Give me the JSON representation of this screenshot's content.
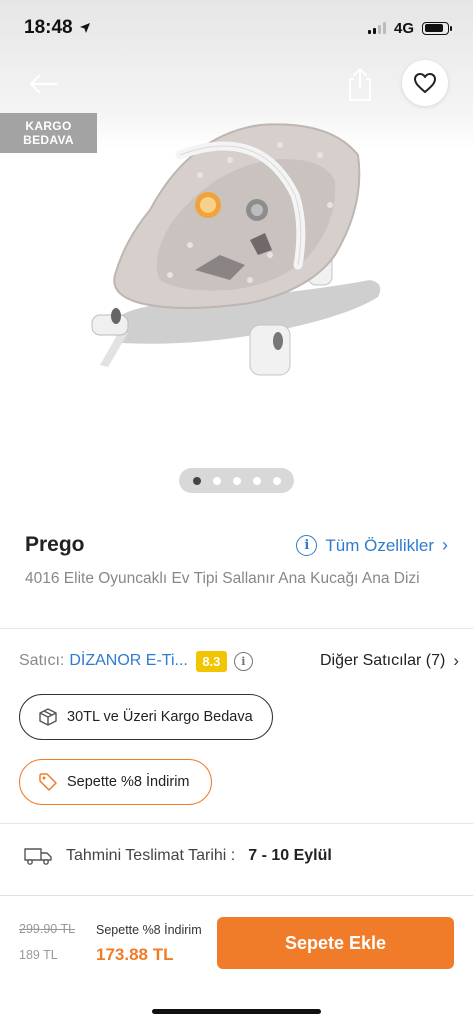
{
  "status_bar": {
    "time": "18:48",
    "network": "4G"
  },
  "hero": {
    "badge_line1": "KARGO",
    "badge_line2": "BEDAVA",
    "carousel_total": 5,
    "carousel_active": 1
  },
  "product": {
    "brand": "Prego",
    "features_link": "Tüm Özellikler",
    "name": "4016 Elite Oyuncaklı Ev Tipi Sallanır Ana Kucağı Ana Dizi"
  },
  "seller": {
    "label": "Satıcı:",
    "name": "DİZANOR E-Ti...",
    "rating": "8.3",
    "other_sellers": "Diğer Satıcılar (7)"
  },
  "tags": {
    "cargo": "30TL ve Üzeri Kargo Bedava",
    "discount": "Sepette %8 İndirim"
  },
  "delivery": {
    "label": "Tahmini Teslimat Tarihi :",
    "value": "7 - 10 Eylül"
  },
  "bottom": {
    "old_price": "299.90 TL",
    "price": "189 TL",
    "promo_label": "Sepette %8 İndirim",
    "final_price": "173.88 TL",
    "add_to_cart": "Sepete Ekle"
  },
  "colors": {
    "accent": "#f07c2a",
    "link": "#2f7bd0",
    "rating": "#f2c500",
    "badge": "#a3a3a3"
  }
}
